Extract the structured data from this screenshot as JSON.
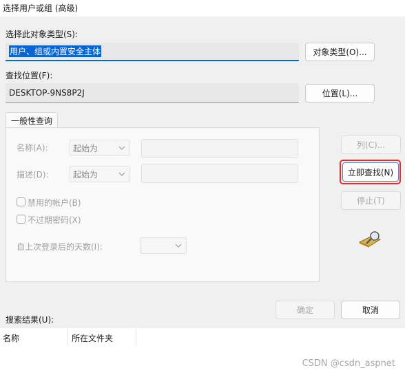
{
  "window": {
    "title": "选择用户或组 (高级)"
  },
  "object_type": {
    "label": "选择此对象类型(S):",
    "value": "用户、组或内置安全主体",
    "button": "对象类型(O)..."
  },
  "location": {
    "label": "查找位置(F):",
    "value": "DESKTOP-9NS8P2J",
    "button": "位置(L)..."
  },
  "tab": {
    "label": "一般性查询"
  },
  "query": {
    "name_label": "名称(A):",
    "name_mode": "起始为",
    "desc_label": "描述(D):",
    "desc_mode": "起始为",
    "disabled_accounts": "禁用的帐户(B)",
    "non_expiring": "不过期密码(X)",
    "days_label": "自上次登录后的天数(I):"
  },
  "side_buttons": {
    "columns": "列(C)...",
    "find_now": "立即查找(N)",
    "stop": "停止(T)"
  },
  "dialog_buttons": {
    "ok": "确定",
    "cancel": "取消"
  },
  "results": {
    "label": "搜索结果(U):",
    "columns": [
      "名称",
      "所在文件夹"
    ]
  },
  "watermark": "CSDN @csdn_aspnet",
  "icons": {
    "search": "magnifier-folder-icon",
    "chevron": "chevron-down-icon"
  }
}
